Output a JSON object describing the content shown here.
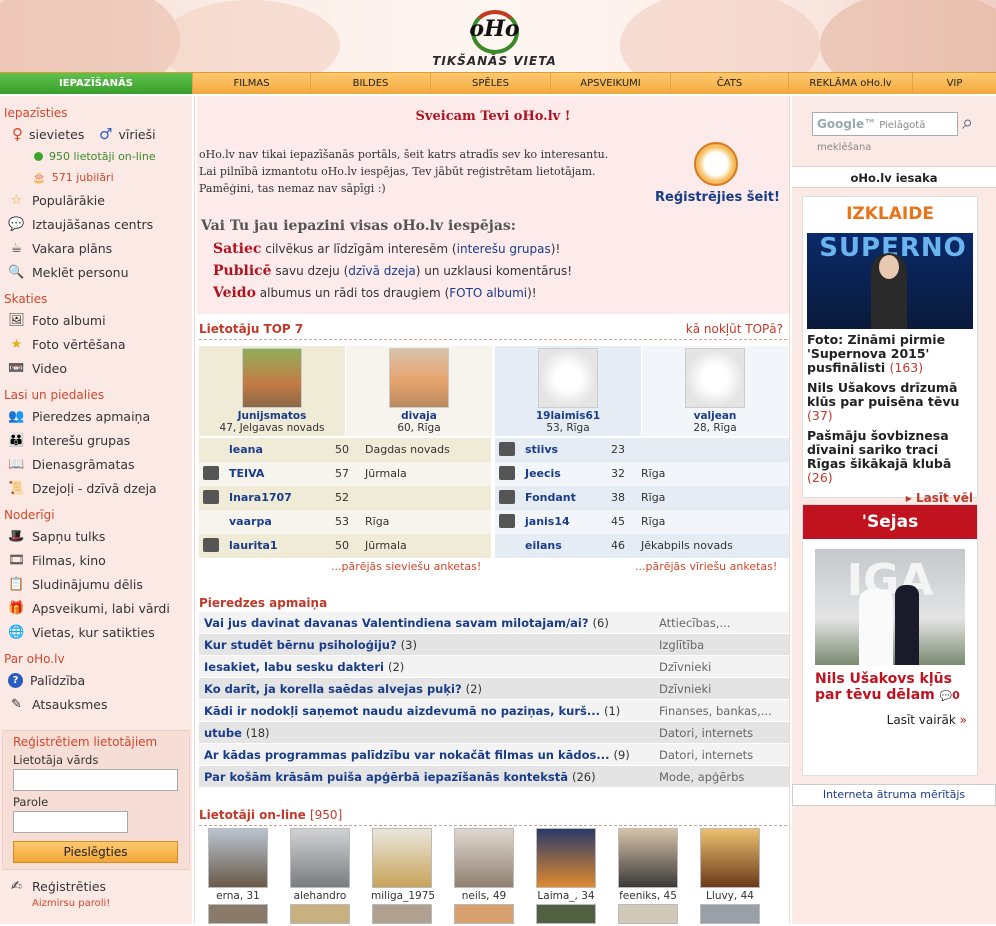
{
  "header": {
    "logo_text": "oHo",
    "logo_sub": "TIKŠANĀS VIETA"
  },
  "nav": [
    {
      "label": "IEPAZĪŠANĀS",
      "active": true
    },
    {
      "label": "FILMAS"
    },
    {
      "label": "BILDES"
    },
    {
      "label": "SPĒLES"
    },
    {
      "label": "APSVEIKUMI"
    },
    {
      "label": "ČATS"
    },
    {
      "label": "REKLĀMA oHo.lv"
    },
    {
      "label": "VIP"
    }
  ],
  "left": {
    "sec_iepazisties": "Iepazīsties",
    "sievietes": "sievietes",
    "virieši": "vīrieši",
    "online": "950 lietotāji on-line",
    "jubilari": "571 jubilāri",
    "populārākie": "Populārākie",
    "iztaujasanas": "Iztaujāšanas centrs",
    "vakara": "Vakara plāns",
    "meklet": "Meklēt personu",
    "sec_skaties": "Skaties",
    "foto_albumi": "Foto albumi",
    "foto_vert": "Foto vērtēšana",
    "video": "Video",
    "sec_lasi": "Lasi un piedalies",
    "pieredzes": "Pieredzes apmaiņa",
    "intereses": "Interešu grupas",
    "dienasgr": "Dienasgrāmatas",
    "dzejoli": "Dzejoļi - dzīvā dzeja",
    "sec_noderigi": "Noderīgi",
    "sapnu": "Sapņu tulks",
    "filmas": "Filmas, kino",
    "sludinajumi": "Sludinājumu dēlis",
    "apsveikumi": "Apsveikumi, labi vārdi",
    "vietas": "Vietas, kur satikties",
    "sec_par": "Par oHo.lv",
    "palidziba": "Palīdzība",
    "atsauksmes": "Atsauksmes",
    "login_title": "Reģistrētiem lietotājiem",
    "login_user": "Lietotāja vārds",
    "login_pass": "Parole",
    "login_btn": "Pieslēgties",
    "registreties": "Reģistrēties",
    "aizmirsu": "Aizmirsu paroli!"
  },
  "welcome": {
    "title": "Sveicam Tevi oHo.lv !",
    "p1": "oHo.lv nav tikai iepazīšanās portāls, šeit katrs atradīs sev ko interesantu.",
    "p2": "Lai pilnībā izmantotu oHo.lv iespējas, Tev jābūt reģistrētam lietotājam.",
    "p3": "Pamēģini, tas nemaz nav sāpīgi :)",
    "reg": "Reģistrējies šeit!",
    "question": "Vai Tu jau iepazini visas oHo.lv iespējas:",
    "f1_b": "Satiec",
    "f1_t": " cilvēkus ar līdzīgām interesēm (",
    "f1_l": "interešu grupas",
    "f1_e": ")!",
    "f2_b": "Publicē",
    "f2_t": " savu dzeju (",
    "f2_l": "dzīvā dzeja",
    "f2_e": ") un uzklausi komentārus!",
    "f3_b": "Veido",
    "f3_t": " albumus un rādi tos draugiem (",
    "f3_l": "FOTO albumi",
    "f3_e": ")!"
  },
  "top7": {
    "title": "Lietotāju TOP 7",
    "link": "kā nokļūt TOPā?",
    "cards": [
      {
        "name": "Junijsmatos",
        "info": "47, Jelgavas novads"
      },
      {
        "name": "divaja",
        "info": "60, Rīga"
      },
      {
        "name": "19laimis61",
        "info": "53, Rīga"
      },
      {
        "name": "valjean",
        "info": "28, Rīga"
      }
    ],
    "women": [
      {
        "name": "leana",
        "age": "50",
        "city": "Dagdas novads"
      },
      {
        "name": "TEIVA",
        "age": "57",
        "city": "Jūrmala"
      },
      {
        "name": "Inara1707",
        "age": "52",
        "city": ""
      },
      {
        "name": "vaarpa",
        "age": "53",
        "city": "Rīga"
      },
      {
        "name": "laurita1",
        "age": "50",
        "city": "Jūrmala"
      }
    ],
    "men": [
      {
        "name": "stiivs",
        "age": "23",
        "city": ""
      },
      {
        "name": "Jeecis",
        "age": "32",
        "city": "Rīga"
      },
      {
        "name": "Fondant",
        "age": "38",
        "city": "Rīga"
      },
      {
        "name": "janis14",
        "age": "45",
        "city": "Rīga"
      },
      {
        "name": "eilans",
        "age": "46",
        "city": "Jēkabpils novads"
      }
    ],
    "more_women": "...pārējās sieviešu anketas!",
    "more_men": "...pārējās vīriešu anketas!"
  },
  "pier": {
    "title": "Pieredzes apmaiņa",
    "rows": [
      {
        "q": "Vai jus davinat davanas Valentindiena savam milotajam/ai?",
        "n": "(6)",
        "cat": "Attiecības,..."
      },
      {
        "q": "Kur studēt bērnu psiholoģiju?",
        "n": "(3)",
        "cat": "Izglītība"
      },
      {
        "q": "Iesakiet, labu sesku dakteri",
        "n": "(2)",
        "cat": "Dzīvnieki"
      },
      {
        "q": "Ko darīt, ja korella saēdas alvejas puķi?",
        "n": "(2)",
        "cat": "Dzīvnieki"
      },
      {
        "q": "Kādi ir nodokļi saņemot naudu aizdevumā no paziņas, kurš...",
        "n": "(1)",
        "cat": "Finanses, bankas,..."
      },
      {
        "q": "utube",
        "n": "(18)",
        "cat": "Datori, internets"
      },
      {
        "q": "Ar kādas programmas palīdzību var nokačāt filmas un kādos...",
        "n": "(9)",
        "cat": "Datori, internets"
      },
      {
        "q": "Par košām krāsām puiša apģērbā iepazīšanās kontekstā",
        "n": "(26)",
        "cat": "Mode, apģērbs"
      }
    ]
  },
  "online": {
    "title": "Lietotāji on-line",
    "count": "[950]",
    "users": [
      {
        "name": "erna, 31"
      },
      {
        "name": "alehandro"
      },
      {
        "name": "miliga_1975"
      },
      {
        "name": "neils, 49"
      },
      {
        "name": "Laima_, 34"
      },
      {
        "name": "feeniks, 45"
      },
      {
        "name": "Lluvy, 44"
      }
    ]
  },
  "right": {
    "search_brand": "Google™",
    "search_placeholder": "Pielāgotā meklēšana",
    "iesaka": "oHo.lv iesaka",
    "izklaide": "IZKLAIDE",
    "banner_word": "SUPERNO",
    "n1": "Foto: Zināmi pirmie 'Supernova 2015' pusfinālisti",
    "n1c": "(163)",
    "n2": "Nils Ušakovs drīzumā klūs par puisēna tēvu",
    "n2c": "(37)",
    "n3": "Pašmāju šovbiznesa dīvaini sariko traci Rīgas šikākajā klubā",
    "n3c": "(26)",
    "lasit": "Lasīt vēl",
    "sejas": "'Sejas",
    "sejas_bg": "IGA",
    "sejas_title": "Nils Ušakovs kļūs par tēvu dēlam",
    "sejas_count": "0",
    "lasit_vairak": "Lasīt vairāk",
    "speedtest": "Interneta ātruma mērītājs"
  }
}
